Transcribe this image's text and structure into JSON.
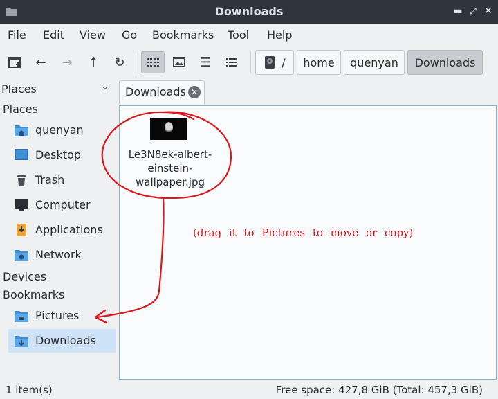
{
  "window": {
    "title": "Downloads"
  },
  "menu": [
    "File",
    "Edit",
    "View",
    "Go",
    "Bookmarks",
    "Tool",
    "Help"
  ],
  "breadcrumb": {
    "root": "/",
    "parts": [
      "home",
      "quenyan",
      "Downloads"
    ]
  },
  "sidebar": {
    "header": "Places",
    "sections": {
      "places": "Places",
      "devices": "Devices",
      "bookmarks": "Bookmarks"
    },
    "places": [
      {
        "label": "quenyan",
        "icon": "home-folder-icon"
      },
      {
        "label": "Desktop",
        "icon": "desktop-icon"
      },
      {
        "label": "Trash",
        "icon": "trash-icon"
      },
      {
        "label": "Computer",
        "icon": "computer-icon"
      },
      {
        "label": "Applications",
        "icon": "applications-icon"
      },
      {
        "label": "Network",
        "icon": "network-icon"
      }
    ],
    "bookmarks": [
      {
        "label": "Pictures",
        "icon": "pictures-folder-icon"
      },
      {
        "label": "Downloads",
        "icon": "downloads-folder-icon",
        "selected": true
      }
    ]
  },
  "tab": {
    "label": "Downloads"
  },
  "file": {
    "name_lines": [
      "Le3N8ek-albert-",
      "einstein-",
      "wallpaper.jpg"
    ]
  },
  "annotation": "(drag it to Pictures to move or copy)",
  "status": {
    "items": "1 item(s)",
    "free_space": "Free space: 427,8 GiB (Total: 457,3 GiB)"
  },
  "colors": {
    "titlebar": "#2f343f",
    "selection": "#cfe3f8",
    "folder": "#3d8fd6",
    "annotation": "#d8181c"
  }
}
